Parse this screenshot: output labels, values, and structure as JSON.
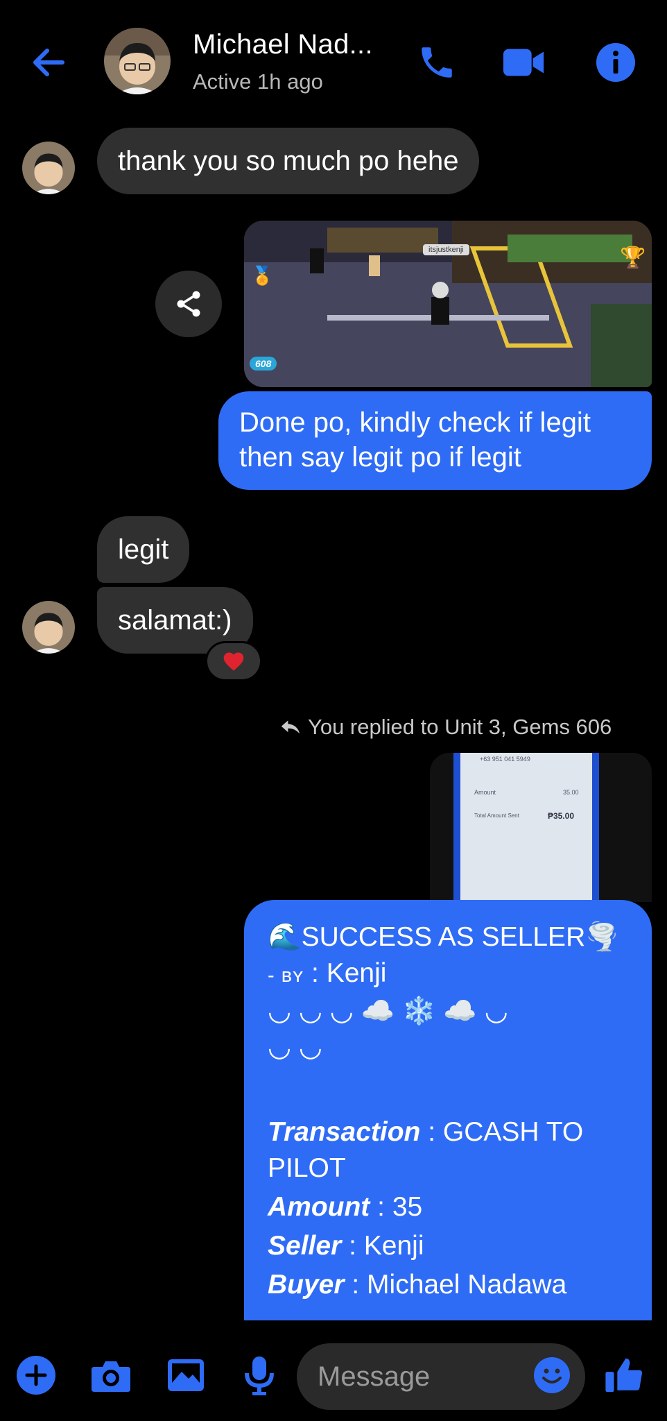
{
  "header": {
    "name": "Michael Nad...",
    "status": "Active 1h ago"
  },
  "messages": {
    "m1": "thank you so much po hehe",
    "m2_line1": "Done po, kindly check if legit",
    "m2_line2": "then say legit po if legit",
    "m3": "legit",
    "m4": "salamat:)",
    "reply_note": "You replied to Unit 3, Gems 606"
  },
  "game_screenshot": {
    "nametag": "itsjustkenji",
    "gems": "608"
  },
  "receipt": {
    "phone": "+63 951 041 5949",
    "amount_label": "Amount",
    "amount_value": "35.00",
    "total_label": "Total Amount Sent",
    "total_value": "₱35.00"
  },
  "seller_card": {
    "title": "SUCCESS AS SELLER",
    "by_prefix": "- ʙʏ",
    "by_value": ": Kenji",
    "deco_line1": "◡ ◡ ◡ ☁️ ❄️ ☁️ ◡",
    "deco_line2": "◡ ◡",
    "transaction_label": "Transaction",
    "transaction_value": ": GCASH TO",
    "transaction_value2": "PILOT",
    "amount_label": "Amount",
    "amount_value": ": 35",
    "seller_label": "Seller",
    "seller_value": ": Kenji",
    "buyer_label": "Buyer",
    "buyer_value": ": Michael Nadawa"
  },
  "composer": {
    "placeholder": "Message"
  },
  "colors": {
    "accent": "#2f6cf6",
    "incoming_bubble": "#303030",
    "heart": "#e0242f"
  },
  "icons": [
    "back-arrow-icon",
    "phone-icon",
    "video-camera-icon",
    "info-icon",
    "share-icon",
    "heart-icon",
    "reply-arrow-icon",
    "plus-icon",
    "camera-icon",
    "image-icon",
    "microphone-icon",
    "emoji-icon",
    "thumbs-up-icon"
  ]
}
